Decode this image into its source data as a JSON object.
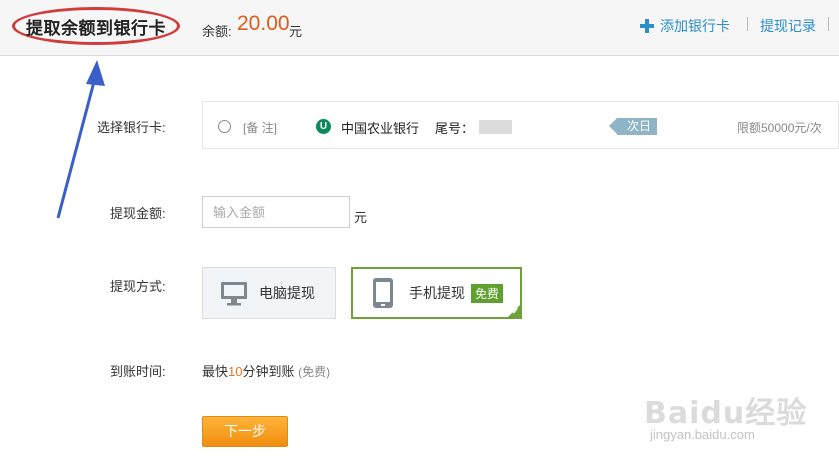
{
  "header": {
    "title": "提取余额到银行卡",
    "balance_label": "余额:",
    "balance_value": "20.00",
    "balance_unit": "元",
    "add_card_label": "添加银行卡",
    "history_label": "提现记录"
  },
  "card_row": {
    "label": "选择银行卡:",
    "remark": "[备 注]",
    "bank_logo_char": "U",
    "bank_name": "中国农业银行",
    "tail_label": "尾号：",
    "arrival_tag": "次日",
    "limit": "限额50000元/次"
  },
  "amount_row": {
    "label": "提现金额:",
    "placeholder": "输入金额",
    "unit": "元"
  },
  "method_row": {
    "label": "提现方式:",
    "options": [
      {
        "label": "电脑提现",
        "icon": "monitor-icon",
        "selected": false
      },
      {
        "label": "手机提现",
        "icon": "tablet-icon",
        "selected": true,
        "badge": "免费"
      }
    ]
  },
  "arrival_row": {
    "label": "到账时间:",
    "prefix": "最快",
    "number": "10",
    "suffix": "分钟到账",
    "note": "(免费)"
  },
  "next_button": "下一步",
  "watermark": {
    "logo": "Baidu经验",
    "url": "jingyan.baidu.com"
  },
  "colors": {
    "accent_orange": "#e05a1b",
    "link_blue": "#2b8fc9",
    "selected_green": "#6da238",
    "annotation_red": "#d03c3c",
    "annotation_arrow": "#3a5fc8"
  }
}
